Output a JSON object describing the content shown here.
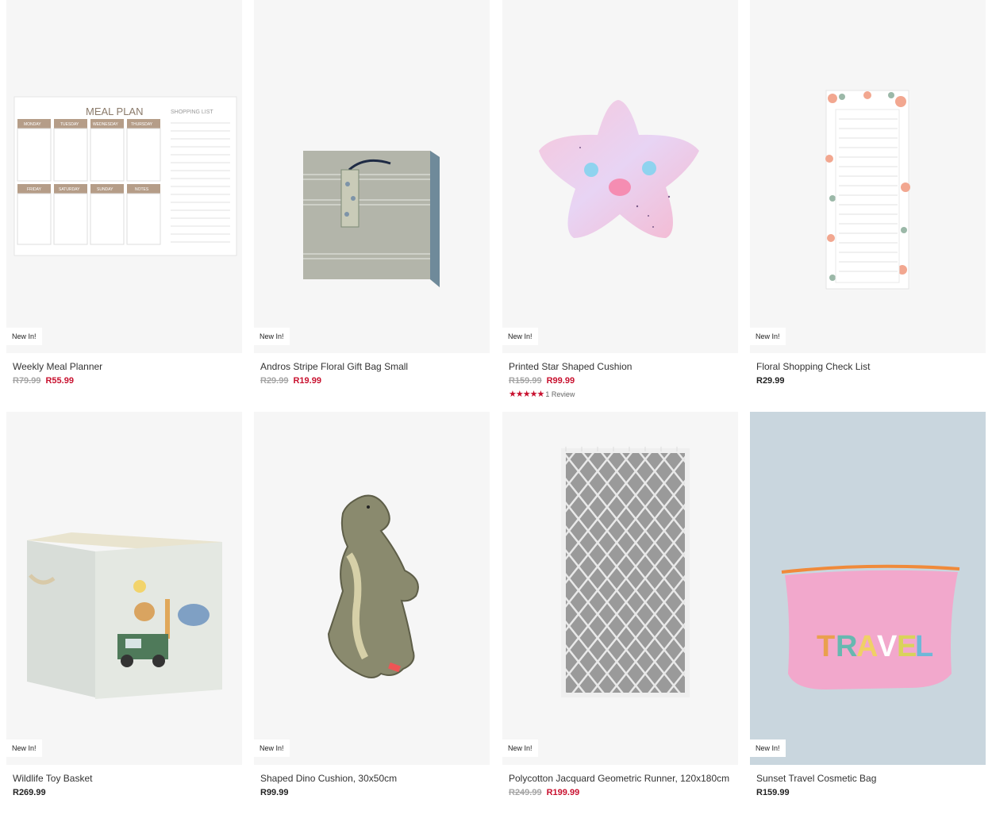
{
  "products": [
    {
      "name": "Weekly Meal Planner",
      "badge": "New In!",
      "was": "R79.99",
      "now": "R55.99"
    },
    {
      "name": "Andros Stripe Floral Gift Bag Small",
      "badge": "New In!",
      "was": "R29.99",
      "now": "R19.99"
    },
    {
      "name": "Printed Star Shaped Cushion",
      "badge": "New In!",
      "was": "R159.99",
      "now": "R99.99",
      "stars": "★★★★★",
      "reviews": "1 Review",
      "rating": 5
    },
    {
      "name": "Floral Shopping Check List",
      "badge": "New In!",
      "price": "R29.99"
    },
    {
      "name": "Wildlife Toy Basket",
      "badge": "New In!",
      "price": "R269.99"
    },
    {
      "name": "Shaped Dino Cushion, 30x50cm",
      "badge": "New In!",
      "price": "R99.99"
    },
    {
      "name": "Polycotton Jacquard Geometric Runner, 120x180cm",
      "badge": "New In!",
      "was": "R249.99",
      "now": "R199.99"
    },
    {
      "name": "Sunset Travel Cosmetic Bag",
      "badge": "New In!",
      "price": "R159.99"
    }
  ],
  "images": {
    "meal_plan_title": "MEAL PLAN",
    "shopping_list": "SHOPPING LIST",
    "days": [
      "MONDAY",
      "TUESDAY",
      "WEDNESDAY",
      "THURSDAY",
      "FRIDAY",
      "SATURDAY",
      "SUNDAY",
      "NOTES"
    ],
    "travel_word": [
      "T",
      "R",
      "A",
      "V",
      "E",
      "L"
    ]
  },
  "colors": {
    "sale": "#c8102e",
    "was": "#a5a5a5",
    "tile_bg": "#f6f6f6"
  }
}
